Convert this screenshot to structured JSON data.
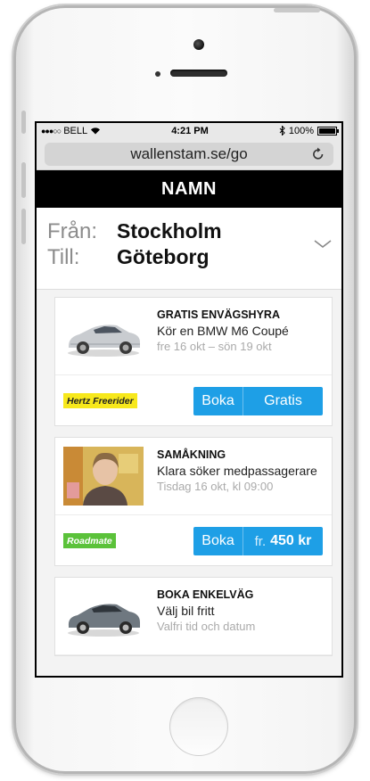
{
  "statusbar": {
    "carrier": "BELL",
    "time": "4:21 PM",
    "battery": "100%"
  },
  "browser": {
    "url": "wallenstam.se/go"
  },
  "header": {
    "title": "NAMN"
  },
  "route": {
    "from_label": "Från:",
    "from_value": "Stockholm",
    "to_label": "Till:",
    "to_value": "Göteborg"
  },
  "cards": [
    {
      "title": "GRATIS ENVÄGSHYRA",
      "line": "Kör en BMW M6 Coupé",
      "sub": "fre 16 okt – sön 19 okt",
      "tag": "Hertz Freerider",
      "book_label": "Boka",
      "price_label": "Gratis"
    },
    {
      "title": "SAMÅKNING",
      "line": "Klara söker medpassagerare",
      "sub": "Tisdag 16 okt, kl 09:00",
      "tag": "Roadmate",
      "book_label": "Boka",
      "price_prefix": "fr.",
      "price_value": "450 kr"
    },
    {
      "title": "BOKA ENKELVÄG",
      "line": "Välj bil fritt",
      "sub": "Valfri tid och datum"
    }
  ],
  "colors": {
    "accent": "#1e9fe6",
    "hertz_tag": "#f7e81c",
    "roadmate_tag": "#5bc23a",
    "header_bg": "#000000"
  },
  "icons": [
    "wifi-icon",
    "bluetooth-icon",
    "battery-icon",
    "reload-icon",
    "chevron-down-icon",
    "car-icon",
    "person-photo"
  ]
}
